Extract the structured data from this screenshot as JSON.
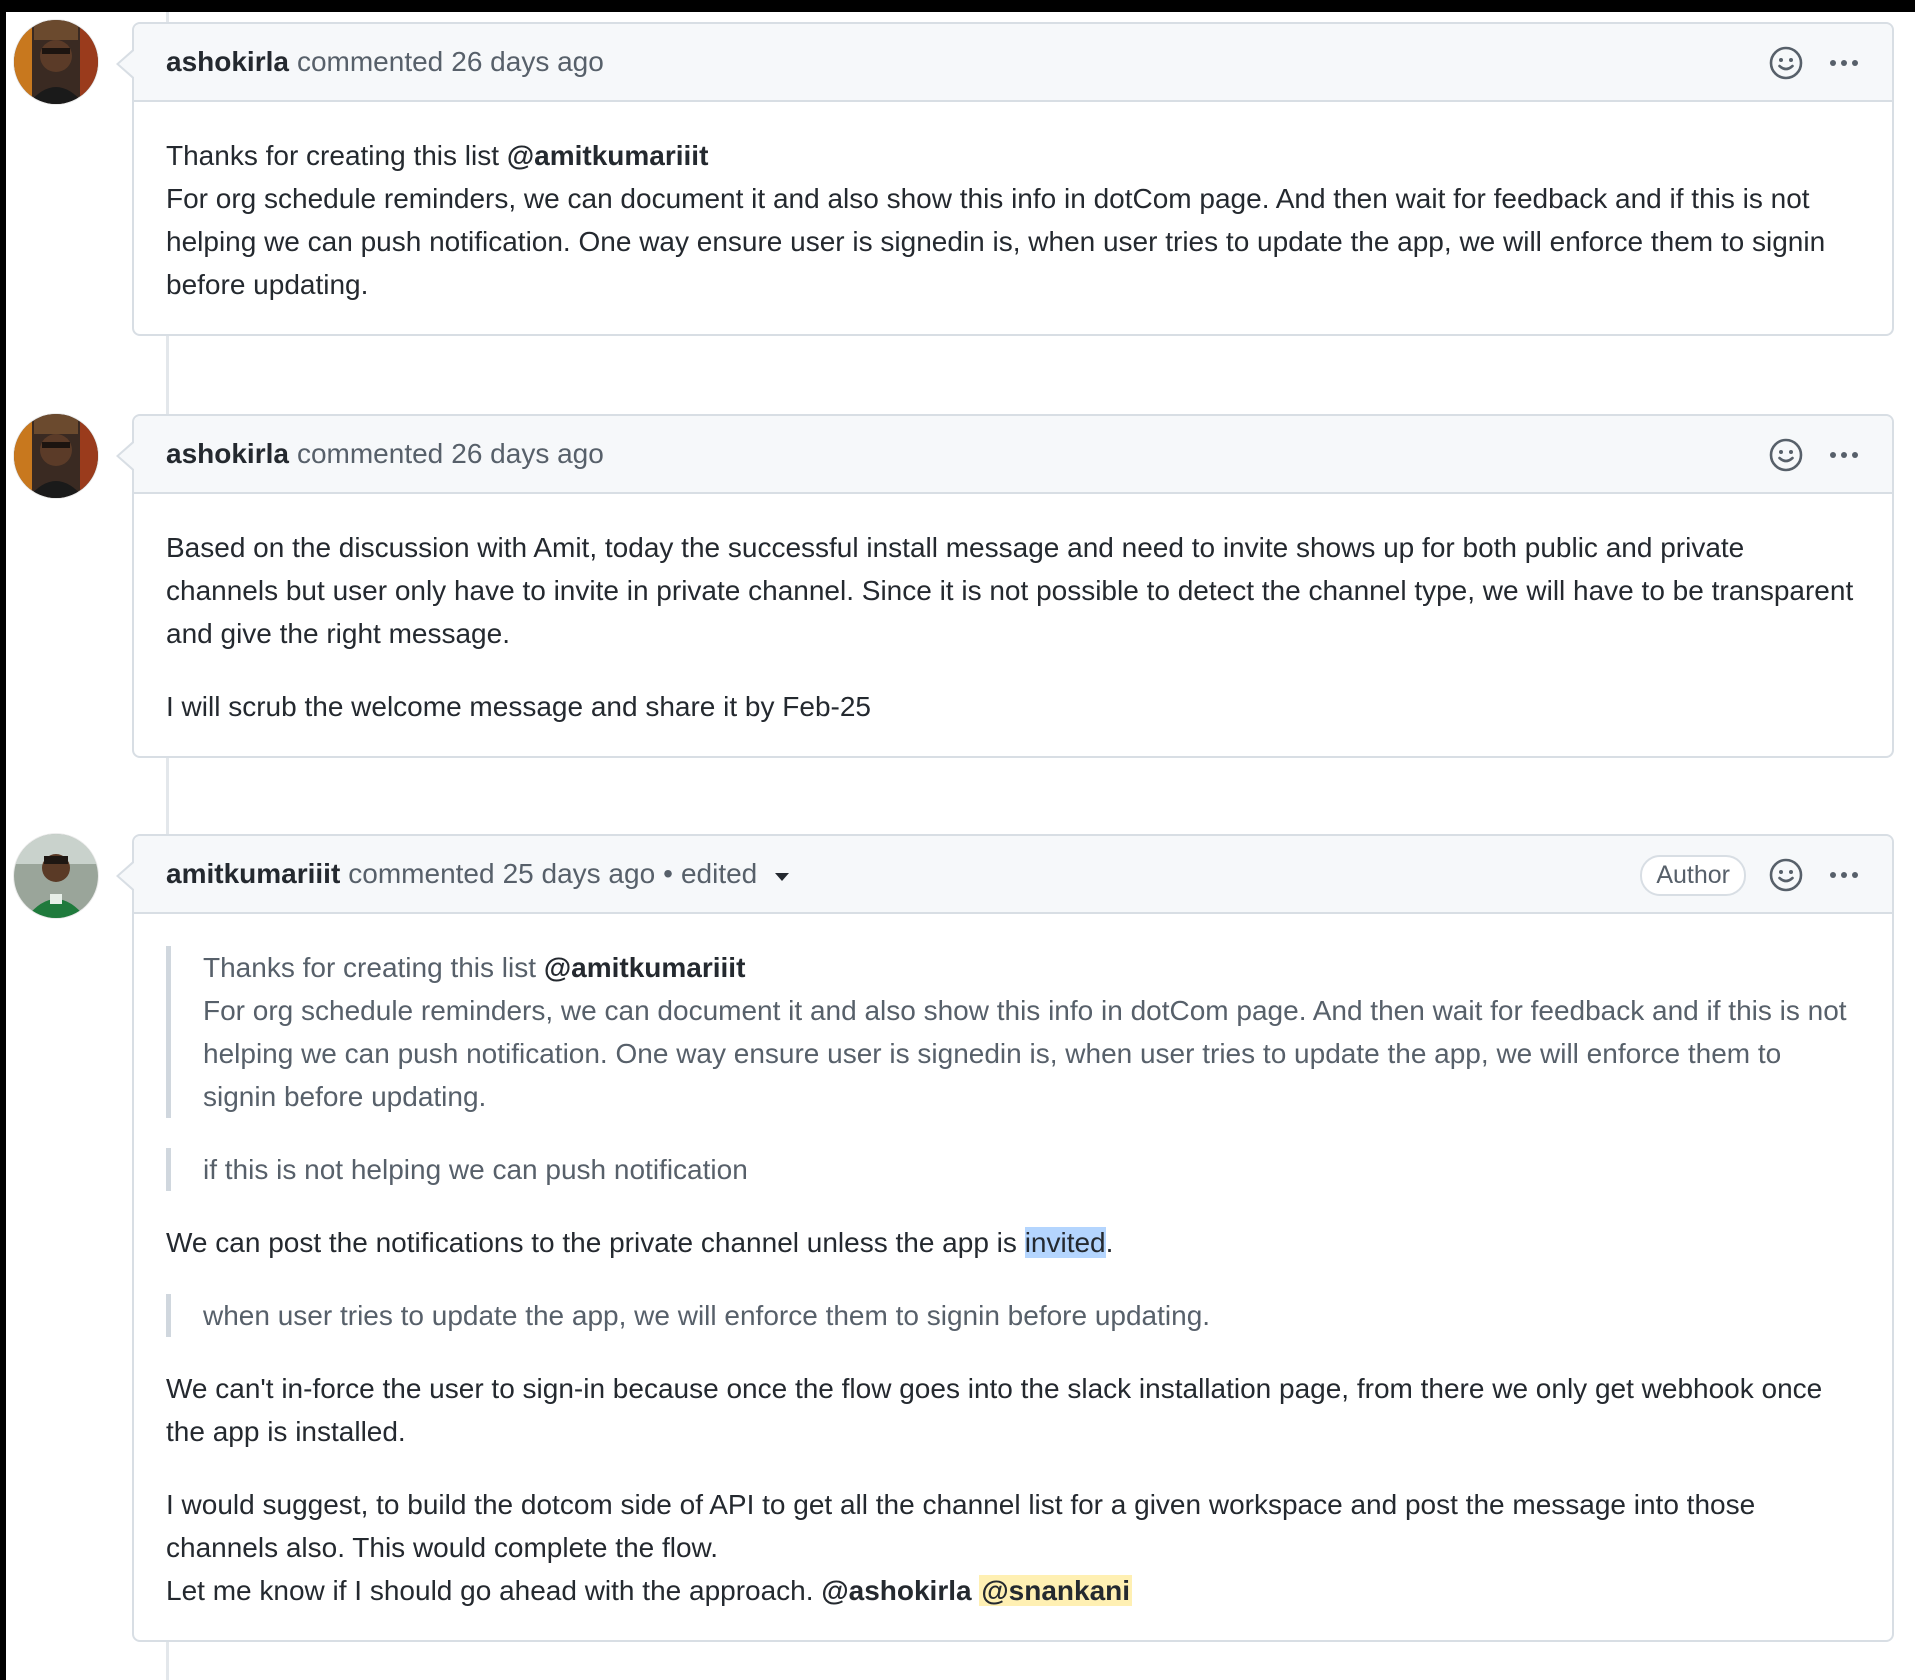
{
  "comments": [
    {
      "author": "ashokirla",
      "action": "commented",
      "time": "26 days ago",
      "body": {
        "p1_line1_text": "Thanks for creating this list ",
        "p1_line1_mention": "@amitkumariiit",
        "p1_rest": "For org schedule reminders, we can document it and also show this info in dotCom page. And then wait for feedback and if this is not helping we can push notification. One way ensure user is signedin is, when user tries to update the app, we will enforce them to signin before updating."
      }
    },
    {
      "author": "ashokirla",
      "action": "commented",
      "time": "26 days ago",
      "body": {
        "p1": "Based on the discussion with Amit, today the successful install message and need to invite shows up for both public and private channels but user only have to invite in private channel. Since it is not possible to detect the channel type, we will have to be transparent and give the right message.",
        "p2": "I will scrub the welcome message and share it by Feb-25"
      }
    },
    {
      "author": "amitkumariiit",
      "action": "commented",
      "time": "25 days ago",
      "separator": "•",
      "edited": "edited",
      "badge": "Author",
      "body": {
        "quote1_line1_text": "Thanks for creating this list ",
        "quote1_line1_mention": "@amitkumariiit",
        "quote1_rest": "For org schedule reminders, we can document it and also show this info in dotCom page. And then wait for feedback and if this is not helping we can push notification. One way ensure user is signedin is, when user tries to update the app, we will enforce them to signin before updating.",
        "quote2": "if this is not helping we can push notification",
        "p1_before": "We can post the notifications to the private channel unless the app is ",
        "p1_selected": "invited",
        "p1_after": ".",
        "quote3": "when user tries to update the app, we will enforce them to signin before updating.",
        "p2": "We can't in-force the user to sign-in because once the flow goes into the slack installation page, from there we only get webhook once the app is installed.",
        "p3_text": "I would suggest, to build the dotcom side of API to get all the channel list for a given workspace and post the message into those channels also. This would complete the flow.",
        "p3_line2": "Let me know if I should go ahead with the approach. ",
        "p3_mention1": "@ashokirla",
        "p3_mention2": "@snankani"
      }
    }
  ],
  "icons": {
    "reaction": "smiley-icon",
    "menu": "kebab-horizontal-icon",
    "dropdown": "chevron-down-icon"
  },
  "colors": {
    "header_bg": "#f6f8fa",
    "border": "#d8dee4",
    "muted_text": "#57606a",
    "mention_highlight": "#fff0b3",
    "selection": "#b4d5fe"
  }
}
